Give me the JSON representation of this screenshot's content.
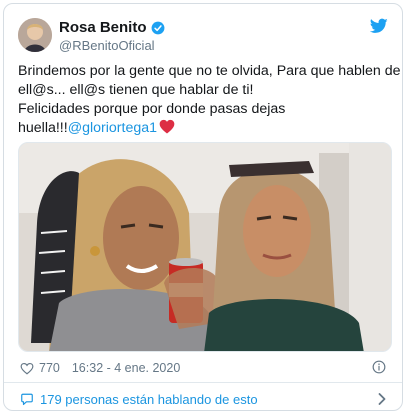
{
  "user": {
    "name": "Rosa Benito",
    "handle": "@RBenitoOficial"
  },
  "tweet": {
    "lines": [
      "Brindemos por la gente que no te olvida, Para que hablen de",
      "ell@s... ell@s tienen que hablar de ti!",
      "Felicidades porque por donde pasas dejas",
      "huella!!!"
    ],
    "mention": "@gloriortega1"
  },
  "meta": {
    "likes": "770",
    "timestamp": "16:32 - 4 ene. 2020"
  },
  "footer": {
    "conversation": "179 personas están hablando de esto"
  },
  "colors": {
    "accent": "#1da1f2",
    "link": "#1b95e0",
    "muted": "#657786"
  },
  "icons": [
    "verified-badge-icon",
    "twitter-bird-icon",
    "heart-outline-icon",
    "info-icon",
    "speech-bubble-icon",
    "chevron-right-icon",
    "red-heart-emoji"
  ]
}
